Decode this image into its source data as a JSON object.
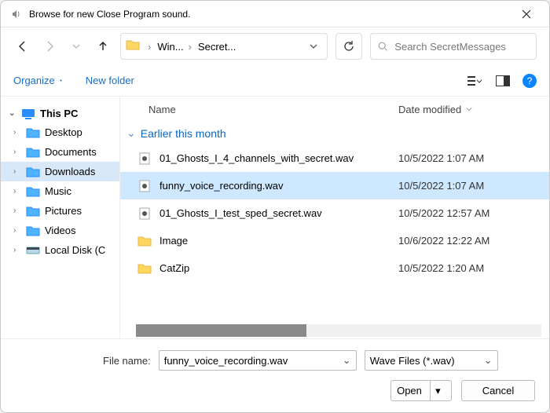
{
  "window": {
    "title": "Browse for new Close Program sound."
  },
  "path": {
    "segment1": "Win...",
    "segment2": "Secret..."
  },
  "search": {
    "placeholder": "Search SecretMessages"
  },
  "toolbar": {
    "organize": "Organize",
    "new_folder": "New folder"
  },
  "sidebar": {
    "root": "This PC",
    "items": [
      {
        "label": "Desktop"
      },
      {
        "label": "Documents"
      },
      {
        "label": "Downloads"
      },
      {
        "label": "Music"
      },
      {
        "label": "Pictures"
      },
      {
        "label": "Videos"
      },
      {
        "label": "Local Disk (C"
      }
    ]
  },
  "columns": {
    "name": "Name",
    "date": "Date modified"
  },
  "group": {
    "label": "Earlier this month"
  },
  "files": [
    {
      "name": "01_Ghosts_I_4_channels_with_secret.wav",
      "date": "10/5/2022 1:07 AM",
      "kind": "audio"
    },
    {
      "name": "funny_voice_recording.wav",
      "date": "10/5/2022 1:07 AM",
      "kind": "audio"
    },
    {
      "name": "01_Ghosts_I_test_sped_secret.wav",
      "date": "10/5/2022 12:57 AM",
      "kind": "audio"
    },
    {
      "name": "Image",
      "date": "10/6/2022 12:22 AM",
      "kind": "folder"
    },
    {
      "name": "CatZip",
      "date": "10/5/2022 1:20 AM",
      "kind": "folder"
    }
  ],
  "selected_index": 1,
  "footer": {
    "file_name_label": "File name:",
    "file_name_value": "funny_voice_recording.wav",
    "filter": "Wave Files (*.wav)",
    "open": "Open",
    "cancel": "Cancel"
  }
}
